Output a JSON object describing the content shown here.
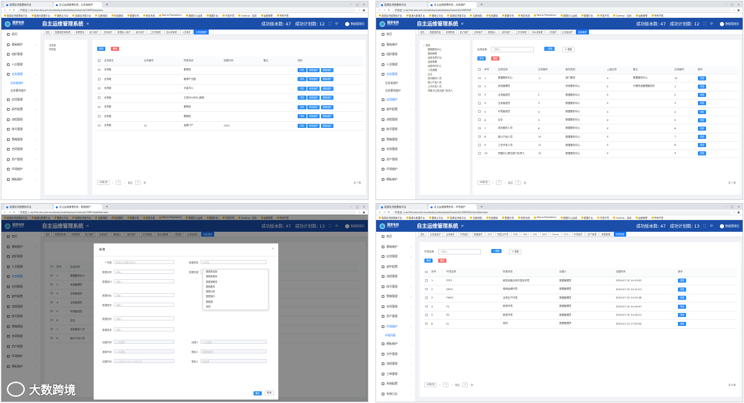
{
  "browser": {
    "tab_1_q1": "能源区块链基础平台",
    "tab_q1": "自主运维管理系统 - 业务组维护",
    "tab_q2": "自主运维管理系统 - 应用维护",
    "tab_q3": "自主运维管理系统 - 数据维护",
    "tab_q4": "自主运维管理系统 - 环境维护",
    "insecure": "不安全",
    "url_q1": "cip.ffml.dev.sdl.cloud/zdy/autodeploy/home/#/CIMP/bizgroup",
    "url_q2": "cip.ffml.dev.sdl.cloud/zdy/autodeploy/home/#/CIMP/BIZ",
    "url_q3": "cip.ffml.dev.sdl.cloud/zdy/autodeploy/home/#/CIMP/dataMaintain",
    "url_q4": "cip.ffml.dev.sdl.cloud/zdy/autodeploy/home/#/CIMP/ENV/envMaintain",
    "bookmarks": [
      "能源区块链基础平台",
      "能源大数据平台",
      "国网云平台",
      "能源区块链平台",
      "百度地图",
      "在线翻译",
      "数据分析",
      "研发系统",
      "Nexus Repository",
      "数据中心运维",
      "数据中台",
      "开发环境",
      "Codeup - 应用",
      "运维管理",
      "所有书签"
    ]
  },
  "app": {
    "logo_title": "国家电网",
    "logo_sub": "STATE GRID",
    "title": "自主运维管理系统",
    "menu_icon": "menu-icon",
    "success_version_label": "成功版本数:",
    "success_version_value": "47",
    "success_plan_label": "成功计划数:",
    "success_plan_value_q1": "12",
    "success_plan_value_q3": "13",
    "success_plan_value_q4": "13",
    "user": "数据管理员"
  },
  "sidebar": {
    "home": "首页",
    "items_main": [
      "首页",
      "基础维护",
      "组织管理",
      "人员管理",
      "业务管理"
    ],
    "biz_sub": [
      "业务组维护",
      "业务模块维护"
    ],
    "items_rest": [
      "应用管理",
      "部件配置",
      "流程管理",
      "账号管理",
      "策略管理",
      "合同管理",
      "资产管理",
      "环境维护",
      "模板维护"
    ],
    "q2_sub": [
      "业务组维护",
      "业务模块维护",
      "应用维护"
    ],
    "q4_rest": [
      "环境维护",
      "环境列表",
      "模板维护",
      "文件管理",
      "流程管理",
      "工单管理",
      "系统配置",
      "系统日志"
    ]
  },
  "q1": {
    "pagetabs": [
      "首页",
      "数据源配置管理",
      "部署配置",
      "能力维护",
      "总体维护",
      "数据接入维护",
      "组件维护",
      "工作流管理",
      "流水线管理",
      "人员维护",
      "业务组维护"
    ],
    "tree": [
      "业务组",
      "环境组"
    ],
    "add": "新增",
    "delete": "删除",
    "headers": [
      "业务组名",
      "业务编号",
      "所属系统",
      "创建时间",
      "备注",
      "操作"
    ],
    "rows": [
      [
        "业务组",
        "",
        "能源站",
        "",
        ""
      ],
      [
        "业务组",
        "",
        "能源产业园",
        "",
        ""
      ],
      [
        "业务组",
        "",
        "计量中心",
        "",
        ""
      ],
      [
        "业务组",
        "",
        "江西分公司大_能耗",
        "",
        ""
      ],
      [
        "业务组",
        "",
        "能耗站",
        "",
        ""
      ],
      [
        "业务组",
        "",
        "数据站",
        "",
        ""
      ],
      [
        "业务组",
        "12",
        "运营门户",
        "2023",
        ""
      ]
    ],
    "op_detail": "详情",
    "op_edit": "修改维护",
    "op_delete": "删除维护",
    "page_size": "10条/页",
    "page_num": "1",
    "goto": "前往",
    "page_unit": "页",
    "total": "共 7 条"
  },
  "q2": {
    "pagetabs": [
      "首页",
      "数据源配置",
      "部署配置",
      "能力维护",
      "总体维护",
      "数据接入",
      "组件维护",
      "工作流管理",
      "流水线管理",
      "人员维护",
      "业务组维护",
      "应用维护"
    ],
    "tree_root": "系统",
    "tree": [
      "数据服务中心",
      "基础管理",
      "运营支撑平台",
      "运营管理",
      "运营资讯中心",
      "人员管理",
      "企业",
      "成功服务人员",
      "核心产品人员",
      "工作开发人员",
      "同管中心提交部门负责人"
    ],
    "search_label": "应用名称",
    "search_placeholder": "请输入",
    "search_btn": "搜索",
    "reset_btn": "重置",
    "add": "新增",
    "delete": "删除",
    "headers": [
      "序号",
      "应用名称",
      "业务编号",
      "服务类型",
      "上级应用",
      "备注",
      "应用编号",
      "操作"
    ],
    "rows": [
      [
        "1",
        "数据服务中心",
        "-1",
        "部门服务",
        "0",
        "数据服务中心",
        "12"
      ],
      [
        "2",
        "系统管理员",
        "",
        "系统服务中心",
        "0",
        "代理系统管理服务员",
        "1"
      ],
      [
        "3",
        "业务组成员",
        "2",
        "数据服务中心",
        "0",
        "",
        "2"
      ],
      [
        "4",
        "业务组成员",
        "3",
        "数据服务中心",
        "0",
        "",
        "3"
      ],
      [
        "5",
        "环境组成员",
        "4",
        "数据服务中心",
        "0",
        "",
        "4"
      ],
      [
        "6",
        "企业",
        "5",
        "数据服务中心",
        "0",
        "",
        "5"
      ],
      [
        "7",
        "成功服务人员",
        "6",
        "数据服务中心",
        "0",
        "",
        "6"
      ],
      [
        "8",
        "核心产品人员",
        "10",
        "数据服务中心",
        "0",
        "",
        "7"
      ],
      [
        "9",
        "工作开发人员",
        "11",
        "数据服务中心",
        "0",
        "",
        "8"
      ],
      [
        "10",
        "同管中心提交部门负责人",
        "12",
        "数据服务中心",
        "0",
        "",
        "9"
      ]
    ],
    "op_detail": "详情",
    "page_size": "10条/页",
    "page_num": "1",
    "goto": "前往",
    "page_unit": "页",
    "total": "共 7 条"
  },
  "q3": {
    "dialog_title": "新增",
    "fields": {
      "belong": "* 所属",
      "belong_value": "能源区块链服务系统",
      "data_type": "数据类型",
      "data_type_placeholder": "请选择",
      "data_name": "数据名称",
      "data_source": "数据来源",
      "data_port": "数据端口",
      "data_address": "数据地址",
      "data_account": "数据账号",
      "data_password": "数据密码",
      "data_desc": "数据描述",
      "create_time": "创建时间",
      "creator": "创建人",
      "update_time": "更新时间",
      "updater": "更新人",
      "time_value": "2024-07-09 17:09:25",
      "admin_value": "数据管理员",
      "placeholder": "请输入",
      "select_placeholder": "请选择"
    },
    "dropdown": [
      "数据库连接",
      "数据库服务",
      "数据源服务",
      "数据服务",
      "数据分析",
      "数据接口",
      "数据源",
      "其他"
    ],
    "confirm": "确定",
    "cancel": "取消"
  },
  "q4": {
    "pagetabs": [
      "首页",
      "业务组维护",
      "应用维护",
      "环境维护",
      "数据维护",
      "ECS",
      "阿里云环境",
      "RDS",
      "SLB",
      "OSS",
      "NAS",
      "Oracle",
      "ECS",
      "环境维护",
      "资产管理",
      "数据管理",
      "环境列表"
    ],
    "search_label": "环境名称",
    "search_placeholder": "请输入",
    "search_btn": "搜索",
    "reset_btn": "重置",
    "add": "新增",
    "delete": "删除",
    "headers": [
      "序号",
      "环境名称",
      "所属系统",
      "创建人",
      "创建时间",
      "操作"
    ],
    "rows": [
      [
        "1",
        "FFF2",
        "研发优服业务开发区环境",
        "数据管理员",
        "2024-07-10 14:15:02"
      ],
      [
        "2",
        "DFF3",
        "电网运维环境",
        "数据管理员",
        "2024-07-10 14:15:21"
      ],
      [
        "3",
        "FWS2",
        "业务生产环境",
        "数据管理员",
        "2024-07-10 14:15:46"
      ],
      [
        "4",
        "F1",
        "研发环境",
        "数据管理员",
        "2024-07-10 14:16:07"
      ],
      [
        "5",
        "E2",
        "研发环境",
        "数据管理员",
        "2024-07-10 14:16:21"
      ],
      [
        "6",
        "t1",
        "测试",
        "数据管理员",
        "2024-07-12 17:05:55"
      ]
    ],
    "op_detail": "详情",
    "page_size": "10条/页",
    "page_num": "1",
    "goto": "前往",
    "page_unit": "页",
    "total": "共 6 条"
  },
  "watermark": "大数跨境"
}
